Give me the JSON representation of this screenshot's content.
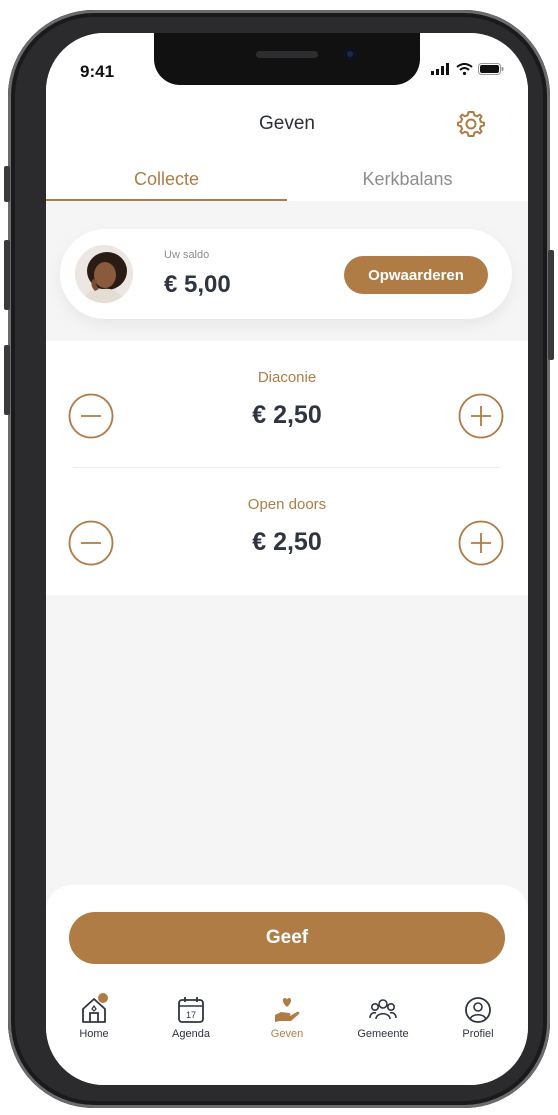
{
  "status": {
    "time": "9:41"
  },
  "header": {
    "title": "Geven"
  },
  "tabs": [
    {
      "label": "Collecte",
      "active": true
    },
    {
      "label": "Kerkbalans",
      "active": false
    }
  ],
  "saldo": {
    "label": "Uw saldo",
    "value": "€ 5,00",
    "button": "Opwaarderen"
  },
  "collections": [
    {
      "name": "Diaconie",
      "amount": "€ 2,50"
    },
    {
      "name": "Open doors",
      "amount": "€ 2,50"
    }
  ],
  "give_button": "Geef",
  "nav": [
    {
      "label": "Home",
      "icon": "home-icon",
      "badge": true
    },
    {
      "label": "Agenda",
      "icon": "calendar-icon",
      "date": "17"
    },
    {
      "label": "Geven",
      "icon": "giving-hand-icon",
      "active": true
    },
    {
      "label": "Gemeente",
      "icon": "people-icon"
    },
    {
      "label": "Profiel",
      "icon": "profile-icon"
    }
  ],
  "colors": {
    "accent": "#b07c45",
    "text": "#2f3440",
    "muted": "#8d8d8d",
    "background": "#f5f5f5"
  }
}
